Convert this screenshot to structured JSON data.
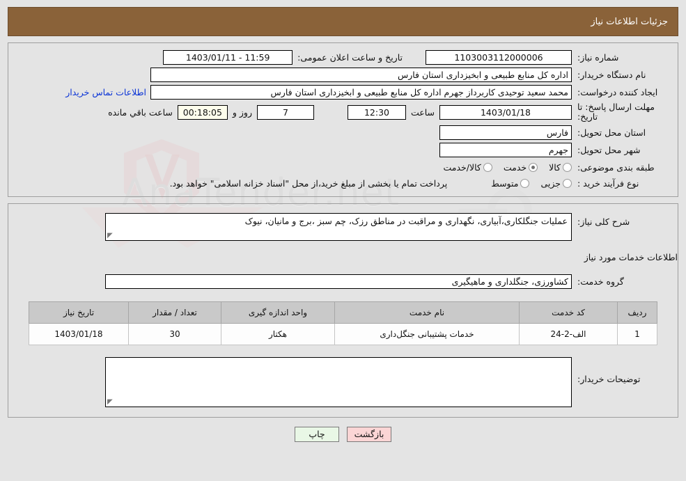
{
  "header": {
    "title": "جزئیات اطلاعات نیاز"
  },
  "form": {
    "need_number_label": "شماره نیاز:",
    "need_number_value": "1103003112000006",
    "announce_datetime_label": "تاریخ و ساعت اعلان عمومی:",
    "announce_datetime_value": "1403/01/11 - 11:59",
    "buyer_org_label": "نام دستگاه خریدار:",
    "buyer_org_value": "اداره کل منابع طبیعی و ابخیزداری استان فارس",
    "requester_label": "ایجاد کننده درخواست:",
    "requester_value": "محمد سعید توحیدی کاربرداز جهرم اداره کل منابع طبیعی و ابخیزداری استان فارس",
    "buyer_contact_link": "اطلاعات تماس خریدار",
    "deadline_label": "مهلت ارسال پاسخ: تا تاریخ:",
    "deadline_date_value": "1403/01/18",
    "hour_label": "ساعت",
    "deadline_time_value": "12:30",
    "days_value": "7",
    "days_label": "روز و",
    "countdown_value": "00:18:05",
    "countdown_label": "ساعت باقي مانده",
    "province_label": "استان محل تحویل:",
    "province_value": "فارس",
    "city_label": "شهر محل تحویل:",
    "city_value": "جهرم",
    "category_label": "طبقه بندی موضوعی:",
    "category_options": [
      {
        "label": "کالا",
        "selected": false
      },
      {
        "label": "خدمت",
        "selected": true
      },
      {
        "label": "کالا/خدمت",
        "selected": false
      }
    ],
    "purchase_type_label": "نوع فرآیند خرید :",
    "purchase_type_options": [
      {
        "label": "جزیی",
        "selected": false
      },
      {
        "label": "متوسط",
        "selected": false
      }
    ],
    "treasury_note": "پرداخت تمام یا بخشی از مبلغ خرید،از محل \"اسناد خزانه اسلامی\" خواهد بود."
  },
  "description": {
    "label": "شرح کلی نیاز:",
    "value": "عملیات جنگلکاری،آبیاری، نگهداری و مراقبت در مناطق رزک، چم سبز ،برج و مانیان، نیوک"
  },
  "services": {
    "section_title": "اطلاعات خدمات مورد نیاز",
    "group_label": "گروه خدمت:",
    "group_value": "کشاورزی، جنگلداری و ماهیگیری",
    "columns": [
      "ردیف",
      "کد خدمت",
      "نام خدمت",
      "واحد اندازه گیری",
      "تعداد / مقدار",
      "تاریخ نیاز"
    ],
    "rows": [
      {
        "index": "1",
        "code": "الف-2-24",
        "name": "خدمات پشتیبانی جنگل‌داری",
        "unit": "هکتار",
        "quantity": "30",
        "need_date": "1403/01/18"
      }
    ]
  },
  "buyer_notes": {
    "label": "توضیحات خریدار:",
    "value": ""
  },
  "footer": {
    "print_label": "چاپ",
    "back_label": "بازگشت"
  },
  "watermark": {
    "text": "AnaTender.net"
  },
  "colors": {
    "titlebar_bg": "#8a6239",
    "link": "#0b34d6",
    "print_btn": "#e9f7e6",
    "back_btn": "#fbd5d5",
    "table_header": "#c9c9c9"
  }
}
